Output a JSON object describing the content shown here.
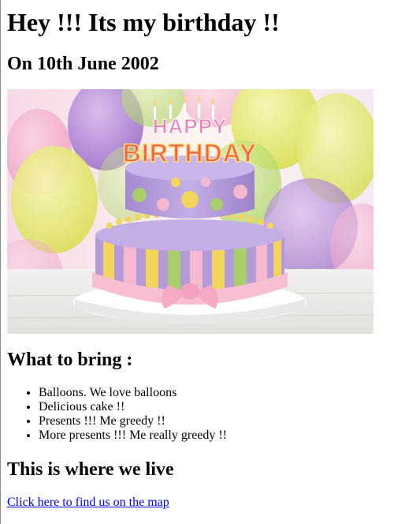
{
  "headline": "Hey !!! Its my birthday !!",
  "date_line": "On 10th June 2002",
  "hero_image": {
    "name": "birthday-cake-image",
    "cake_topper_words": [
      "HAPPY",
      "BIRTHDAY"
    ],
    "colors": {
      "balloon_yellow": "#e9ec7a",
      "balloon_purple": "#b58bd9",
      "balloon_pink": "#f2a9c9",
      "cake_lavender": "#b49ad8",
      "cake_green": "#a8cf6a",
      "cake_pink": "#f6b8cf",
      "cake_yellow": "#f3d55b"
    }
  },
  "bring_section": {
    "heading": "What to bring :",
    "items": [
      "Balloons. We love balloons",
      "Delicious cake !!",
      "Presents !!! Me greedy !!",
      "More presents !!! Me really greedy !!"
    ]
  },
  "location_section": {
    "heading": "This is where we live",
    "link_text": "Click here to find us on the map",
    "link_color": "#0000ee"
  }
}
